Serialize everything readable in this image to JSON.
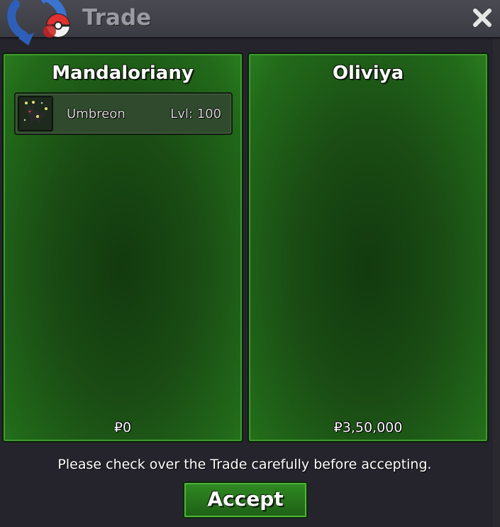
{
  "window": {
    "title": "Trade",
    "close_icon": "close-icon"
  },
  "trade": {
    "left": {
      "player_name": "Mandaloriany",
      "pokemon": [
        {
          "name": "Umbreon",
          "level": "Lvl: 100",
          "icon": "umbreon-sprite-icon"
        }
      ],
      "money": "₽0"
    },
    "right": {
      "player_name": "Oliviya",
      "pokemon": [],
      "money": "₽3,50,000"
    }
  },
  "footer": {
    "notice": "Please check over the Trade carefully before accepting.",
    "accept_label": "Accept"
  },
  "colors": {
    "panel_green": "#1a4c14",
    "accept_green": "#2f8a22",
    "window_bg": "#25242d"
  }
}
